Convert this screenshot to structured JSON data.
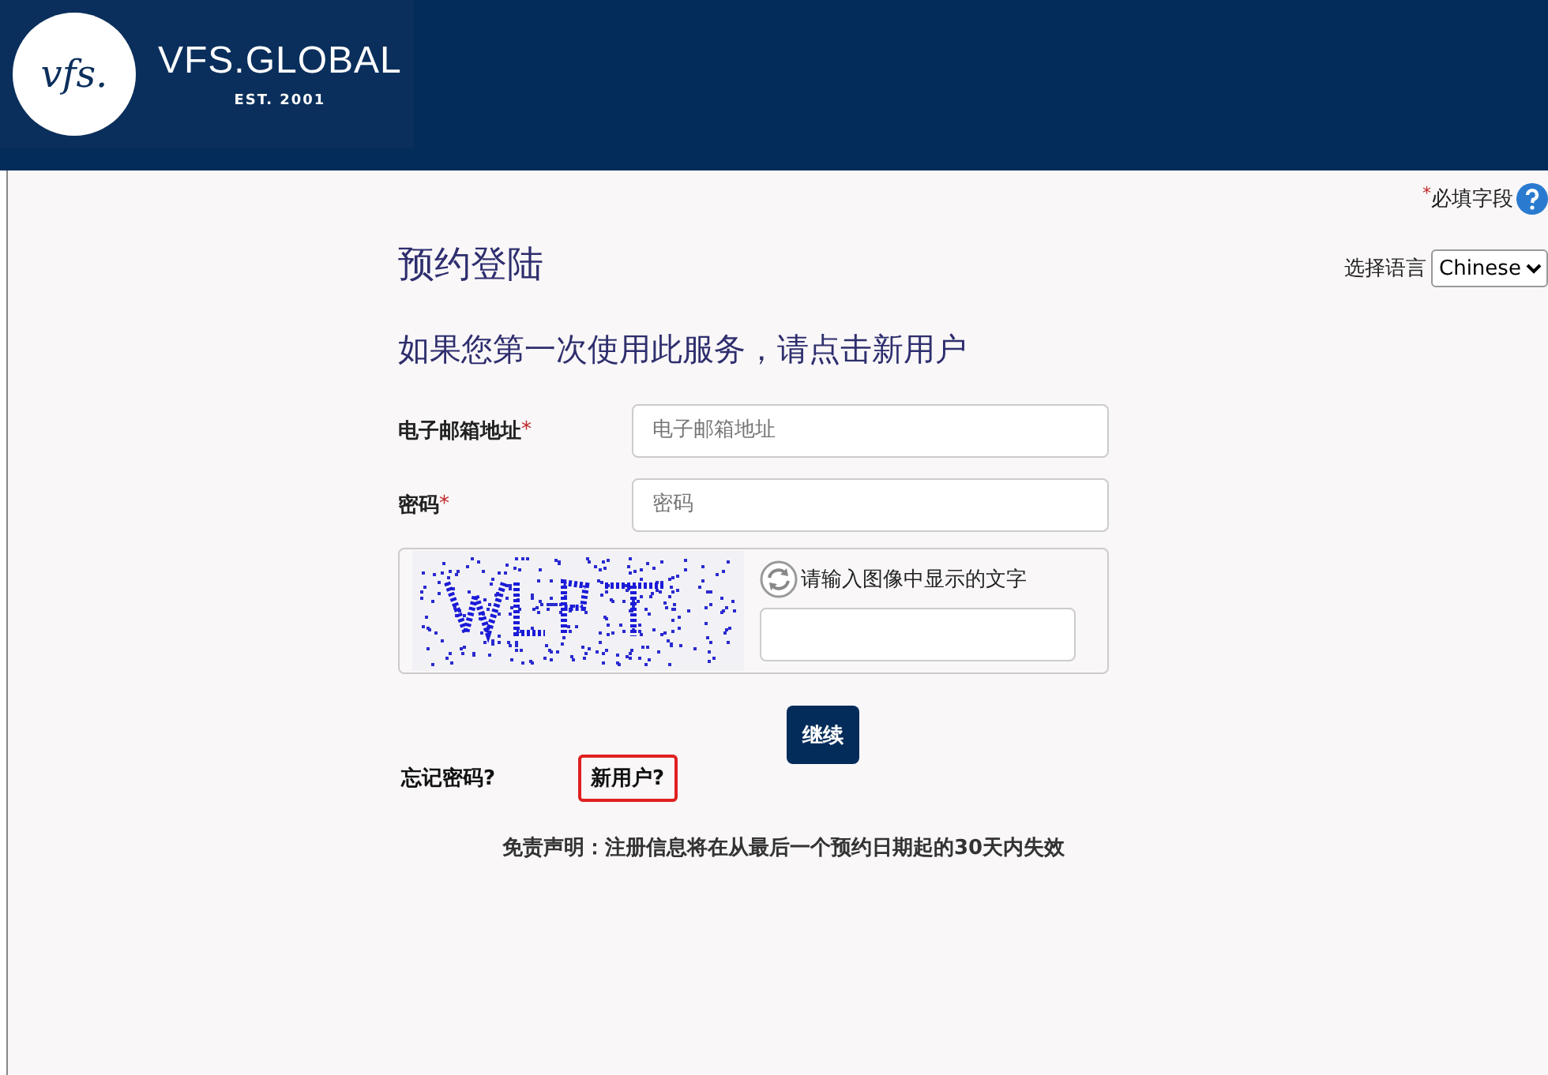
{
  "header": {
    "logo_mark": "vfs.",
    "logo_name": "VFS.GLOBAL",
    "logo_tagline": "EST. 2001"
  },
  "required_legend": {
    "mark": "*",
    "text": "必填字段"
  },
  "language": {
    "label": "选择语言",
    "value": "Chinese"
  },
  "title": "预约登陆",
  "subtitle": "如果您第一次使用此服务，请点击新用户",
  "fields": [
    {
      "label": "电子邮箱地址",
      "required": true,
      "placeholder": "电子邮箱地址"
    },
    {
      "label": "密码",
      "required": true,
      "placeholder": "密码"
    }
  ],
  "captcha": {
    "prompt": "请输入图像中显示的文字"
  },
  "submit_button": "继续",
  "links": [
    {
      "label": "忘记密码?",
      "highlighted": false
    },
    {
      "label": "新用户?",
      "highlighted": true
    }
  ],
  "disclaimer": "免责声明：注册信息将在从最后一个预约日期起的30天内失效"
}
